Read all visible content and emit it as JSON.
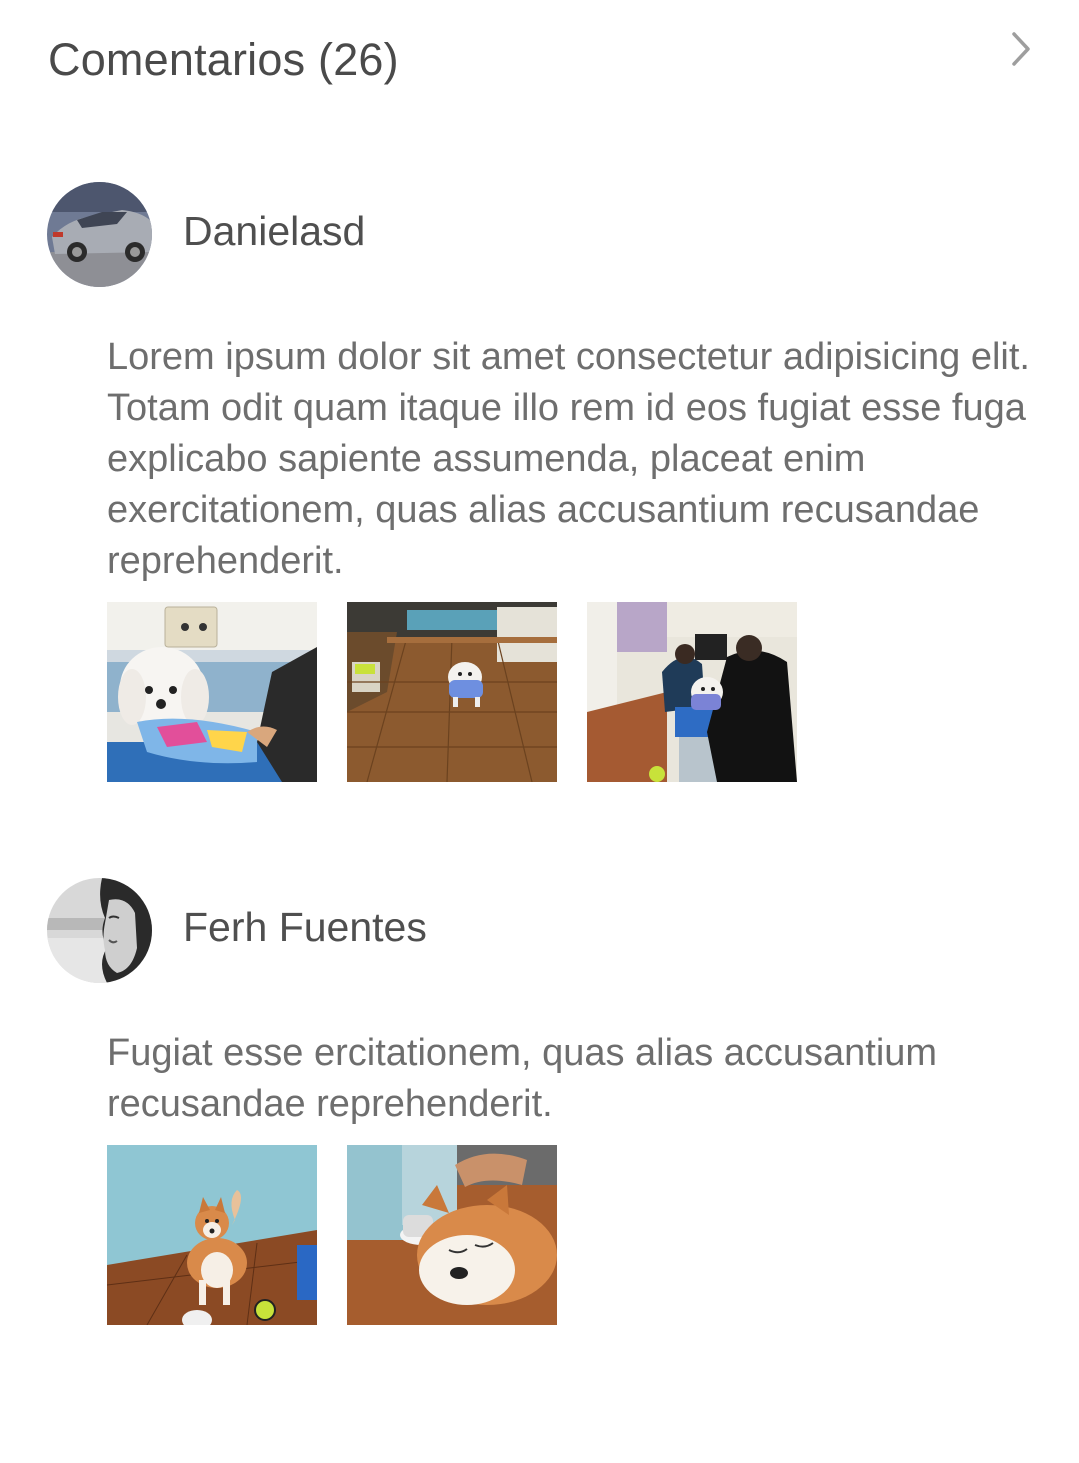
{
  "header": {
    "title": "Comentarios (26)",
    "chevron_icon": "chevron-right-icon"
  },
  "comments": [
    {
      "author": "Danielasd",
      "avatar_icon": "car-avatar",
      "text": "Lorem ipsum dolor sit amet consectetur adipisicing elit. Totam odit quam itaque illo rem id eos fugiat esse fuga explicabo sapiente assumenda, placeat enim exercitationem, quas alias accusantium recusandae reprehenderit.",
      "photos": [
        "white-dog-on-table-photo",
        "dog-in-clinic-hall-photo",
        "dog-with-people-photo"
      ]
    },
    {
      "author": "Ferh Fuentes",
      "avatar_icon": "woman-portrait-avatar",
      "text": "Fugiat esse ercitationem, quas alias accusantium recusandae reprehenderit.",
      "photos": [
        "akita-standing-photo",
        "akita-sleeping-photo"
      ]
    }
  ],
  "colors": {
    "title": "#4a4a4a",
    "author": "#4f4f4f",
    "body_text": "#6e6e6e",
    "chevron": "#9e9e9e"
  }
}
